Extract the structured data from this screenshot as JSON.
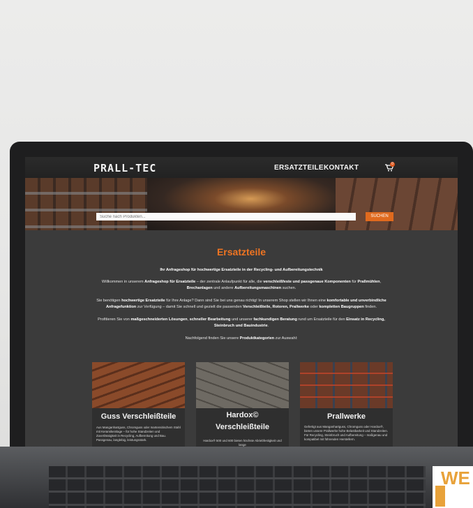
{
  "site": {
    "logo": "PRALL-TEC",
    "nav": [
      "ERSATZTEILE",
      "KONTAKT"
    ],
    "cart_count": "0"
  },
  "search": {
    "placeholder": "Suche nach Produkten...",
    "button": "SUCHEN"
  },
  "main": {
    "title": "Ersatzteile",
    "intro": "Ihr Anfrageshop für hochwertige Ersatzteile in der Recycling- und Aufbereitungstechnik",
    "p1a": "Willkommen in unserem ",
    "p1b": "Anfrageshop für Ersatzteile",
    "p1c": " – der zentrale Anlaufpunkt für alle, die ",
    "p1d": "verschleißfeste und passgenaue Komponenten",
    "p1e": " für ",
    "p1f": "Prallmühlen",
    "p1g": ",",
    "p1h": "Brechanlagen",
    "p1i": " und andere ",
    "p1j": "Aufbereitungsmaschinen",
    "p1k": " suchen.",
    "p2a": "Sie benötigen ",
    "p2b": "hochwertige Ersatzteile",
    "p2c": " für Ihre Anlage? Dann sind Sie bei uns genau richtig! In unserem Shop stellen wir Ihnen eine ",
    "p2d": "komfortable und unverbindliche",
    "p2e": "Anfragefunktion",
    "p2f": " zur Verfügung – damit Sie schnell und gezielt die passenden ",
    "p2g": "Verschleißteile, Rotoren, Prallwerke",
    "p2h": " oder ",
    "p2i": "kompletten Baugruppen",
    "p2j": " finden.",
    "p3a": "Profitieren Sie von ",
    "p3b": "maßgeschneiderten Lösungen",
    "p3c": ", ",
    "p3d": "schneller Bearbeitung",
    "p3e": " und unserer ",
    "p3f": "fachkundigen Beratung",
    "p3g": " rund um Ersatzteile für den ",
    "p3h": "Einsatz in Recycling,",
    "p3i": "Steinbruch und Bauindustrie",
    "p3j": ".",
    "p4a": "Nachfolgend finden Sie unsere ",
    "p4b": "Produktkategorien",
    "p4c": " zur Auswahl:"
  },
  "categories": [
    {
      "name": "Guss Verschleißteile",
      "desc": "Aus Manganhartguss, Chromguss oder martensitischem Stahl mit Keramikeinlage – für hohe Standzeiten und Zuverlässigkeit in Recycling, Aufbereitung und Bau. Passgenau, langlebig, leistungsstark."
    },
    {
      "name": "Hardox© Verschleißteile",
      "desc": "Hardox® 500 und 600 bieten höchste Abriebfestigkeit und lange"
    },
    {
      "name": "Prallwerke",
      "desc": "Gefertigt aus Manganhartguss, Chromguss oder Hardox®, bieten unsere Prallwerke hohe Belastbarkeit und Standzeiten. Für Recycling, Steinbruch und Aufbereitung – maßgenau und kompatibel mit führenden Herstellern."
    }
  ],
  "watermark": "WE"
}
